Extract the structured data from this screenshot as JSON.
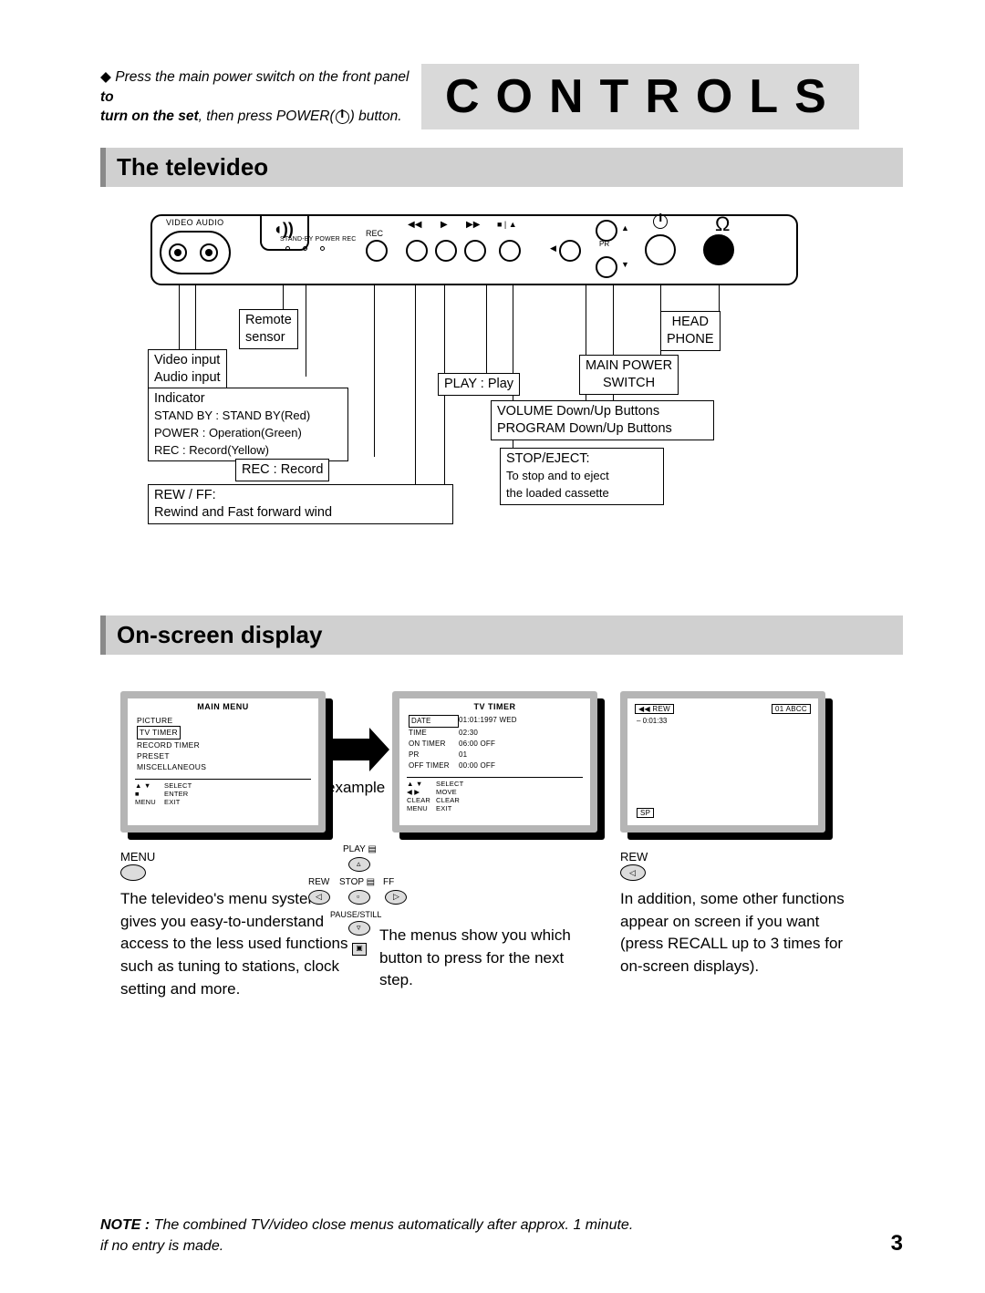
{
  "header": {
    "intro_prefix": "Press the main power switch on the front panel ",
    "intro_bold1": "to",
    "intro_bold2": "turn on the set",
    "intro_mid": ", then press POWER(",
    "intro_suffix": ") button.",
    "controls_title": "CONTROLS"
  },
  "section1": {
    "heading": "The televideo"
  },
  "panel": {
    "video_label": "VIDEO",
    "audio_label": "AUDIO",
    "ind_labels": "STAND-BY  POWER    REC",
    "rec": "REC",
    "pr": "PR"
  },
  "callouts": {
    "remote_sensor": "Remote\nsensor",
    "video_audio_input": "Video input\nAudio input",
    "indicator_title": "Indicator",
    "indicator_lines": "STAND BY : STAND BY(Red)\nPOWER : Operation(Green)\nREC : Record(Yellow)",
    "rec_record": "REC : Record",
    "rew_ff_title": "REW / FF:",
    "rew_ff_body": "Rewind and Fast forward wind",
    "play": "PLAY : Play",
    "stop_eject_title": "STOP/EJECT:",
    "stop_eject_body": "To stop and to eject\nthe loaded cassette",
    "volume_program": "VOLUME Down/Up Buttons\nPROGRAM Down/Up Buttons",
    "main_power": "MAIN POWER\nSWITCH",
    "head_phone": "HEAD\nPHONE"
  },
  "section2": {
    "heading": "On-screen display"
  },
  "osd": {
    "main_menu_title": "MAIN MENU",
    "mm_items": {
      "i0": "PICTURE",
      "i1": "TV TIMER",
      "i2": "RECORD TIMER",
      "i3": "PRESET",
      "i4": "MISCELLANEOUS"
    },
    "mm_bottom": {
      "l1a": "▲ ▼",
      "l1b": "SELECT",
      "l2a": "■",
      "l2b": "ENTER",
      "l3a": "MENU",
      "l3b": "EXIT"
    },
    "tv_timer_title": "TV TIMER",
    "tt_rows": {
      "r0a": "DATE",
      "r0b": "01:01:1997 WED",
      "r1a": "TIME",
      "r1b": "02:30",
      "r2a": "ON TIMER",
      "r2b": "06:00 OFF",
      "r3a": "PR",
      "r3b": "01",
      "r4a": "OFF TIMER",
      "r4b": "00:00 OFF"
    },
    "tt_bottom": {
      "l1a": "▲ ▼",
      "l1b": "SELECT",
      "l2a": "◀ ▶",
      "l2b": "MOVE",
      "l3a": "CLEAR",
      "l3b": "CLEAR",
      "l4a": "MENU",
      "l4b": "EXIT"
    },
    "rew_badge": "◀◀ REW",
    "time_badge": "– 0:01:33",
    "abcc_badge": "01 ABCC",
    "sp_badge": "SP",
    "example": "example",
    "menu_lbl": "MENU",
    "play_lbl": "PLAY",
    "rew_lbl": "REW",
    "stop_lbl": "STOP",
    "ff_lbl": "FF",
    "pause_lbl": "PAUSE/STILL",
    "rew_btn_lbl": "REW",
    "col1": "The televideo's menu system gives you easy-to-understand access to the less used functions such as tuning to stations, clock setting and more.",
    "col2": "The menus show you which button to press for the next step.",
    "col3": "In addition, some other functions appear on screen if you want (press RECALL up to 3 times for on-screen displays)."
  },
  "footer": {
    "note_bold": "NOTE :",
    "note_body": " The combined TV/video close menus automatically after approx. 1 minute.\nif no entry is made.",
    "page": "3"
  }
}
